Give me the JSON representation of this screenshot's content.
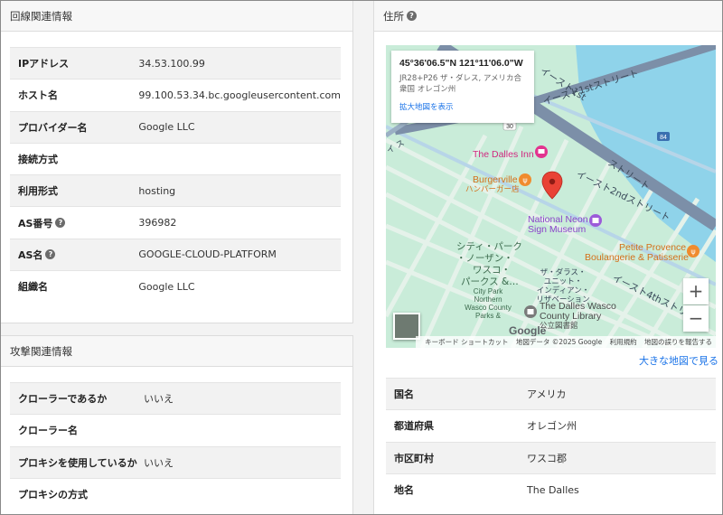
{
  "line_info": {
    "header": "回線関連情報",
    "rows": [
      {
        "label": "IPアドレス",
        "value": "34.53.100.99"
      },
      {
        "label": "ホスト名",
        "value": "99.100.53.34.bc.googleusercontent.com"
      },
      {
        "label": "プロバイダー名",
        "value": "Google LLC"
      },
      {
        "label": "接続方式",
        "value": ""
      },
      {
        "label": "利用形式",
        "value": "hosting"
      },
      {
        "label": "AS番号",
        "value": "396982"
      },
      {
        "label": "AS名",
        "value": "GOOGLE-CLOUD-PLATFORM"
      },
      {
        "label": "組織名",
        "value": "Google LLC"
      }
    ]
  },
  "attack_info": {
    "header": "攻撃関連情報",
    "rows": [
      {
        "label": "クローラーであるか",
        "value": "いいえ"
      },
      {
        "label": "クローラー名",
        "value": ""
      },
      {
        "label": "プロキシを使用しているか",
        "value": "いいえ"
      },
      {
        "label": "プロキシの方式",
        "value": ""
      }
    ]
  },
  "address": {
    "header": "住所",
    "help_glyph": "?",
    "map": {
      "infobox": {
        "coords": "45°36'06.5\"N 121°11'06.0\"W",
        "address": "JR28+P26 ザ・ダレス, アメリカ合衆国 オレゴン州",
        "enlarge_link": "拡大地図を表示"
      },
      "labels": {
        "dalles_inn": "The Dalles Inn",
        "burgerville": "Burgerville",
        "burgerville_sub": "ハンバーガー店",
        "neon_1": "National Neon",
        "neon_2": "Sign Museum",
        "petite_1": "Petite Provence",
        "petite_2": "Boulangerie & Patisserie",
        "city_park_jp_1": "シティ・パーク",
        "city_park_jp_2": "・ノーザン・",
        "city_park_jp_3": "ワスコ・",
        "city_park_jp_4": "パークス &…",
        "city_park_en_1": "City Park",
        "city_park_en_2": "Northern",
        "city_park_en_3": "Wasco County",
        "city_park_en_4": "Parks &",
        "library_jp_1": "ザ・ダラス・",
        "library_jp_2": "ユニット・",
        "library_jp_3": "インディアン・",
        "library_jp_4": "リザベーション",
        "library_en_1": "The Dalles Wasco",
        "library_en_2": "County Library",
        "library_en_3": "公立図書館",
        "street_e1st_top": "イースト1stストリート",
        "street_e1st_right_1": "イースト1st",
        "street_e1st_right_2": "ストリート",
        "street_e2nd": "イースト2ndストリート",
        "street_e4th": "イースト4thストリート",
        "street_left": "イ ス",
        "route_30": "30",
        "route_84": "84"
      },
      "zoom_in": "+",
      "zoom_out": "−",
      "google": "Google",
      "attribution": {
        "shortcuts": "キーボード ショートカット",
        "map_data": "地図データ ©2025 Google",
        "terms": "利用規約",
        "report": "地図の誤りを報告する"
      }
    },
    "big_map_link": "大きな地図で見る",
    "rows": [
      {
        "label": "国名",
        "value": "アメリカ"
      },
      {
        "label": "都道府県",
        "value": "オレゴン州"
      },
      {
        "label": "市区町村",
        "value": "ワスコ郡"
      },
      {
        "label": "地名",
        "value": "The Dalles"
      }
    ]
  },
  "colors": {
    "map_land": "#c9ecd9",
    "map_water": "#8fd3ea",
    "highway": "#7c8fa8",
    "marker": "#e94235",
    "poi_pink": "#e2338f",
    "poi_orange": "#f08b2e",
    "poi_purple": "#9c5bd9",
    "link_blue": "#1a73e8"
  }
}
